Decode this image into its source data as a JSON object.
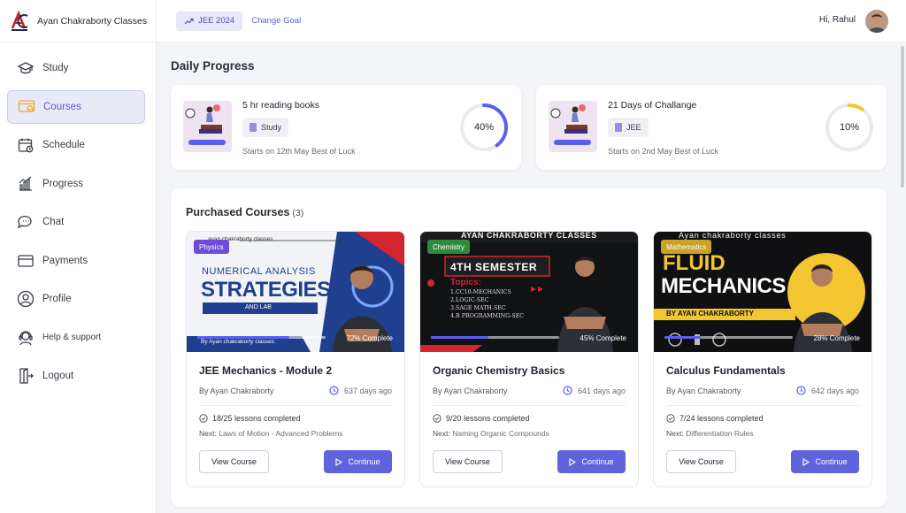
{
  "brand": {
    "name": "Ayan Chakraborty Classes"
  },
  "sidebar": {
    "items": [
      {
        "label": "Study",
        "icon": "graduation-cap-icon"
      },
      {
        "label": "Courses",
        "icon": "courses-icon",
        "active": true
      },
      {
        "label": "Schedule",
        "icon": "calendar-icon"
      },
      {
        "label": "Progress",
        "icon": "progress-icon"
      },
      {
        "label": "Chat",
        "icon": "chat-icon"
      },
      {
        "label": "Payments",
        "icon": "card-icon"
      },
      {
        "label": "Profile",
        "icon": "user-icon"
      },
      {
        "label": "Help & support",
        "icon": "headset-icon"
      },
      {
        "label": "Logout",
        "icon": "logout-icon"
      }
    ]
  },
  "topbar": {
    "goal": "JEE 2024",
    "change_goal": "Change Goal",
    "greeting": "Hi, Rahul"
  },
  "daily_progress": {
    "title": "Daily Progress",
    "cards": [
      {
        "title": "5 hr reading books",
        "tag": "Study",
        "subtitle": "Starts on 12th May Best of Luck",
        "percent": 40,
        "percent_label": "40%",
        "ring_color": "#5b5ff0"
      },
      {
        "title": "21 Days of Challange",
        "tag": "JEE",
        "subtitle": "Starts on 2nd May Best of Luck",
        "percent": 10,
        "percent_label": "10%",
        "ring_color": "#f2c531"
      }
    ]
  },
  "purchased": {
    "title": "Purchased Courses",
    "count": "(3)",
    "courses": [
      {
        "subject": "Physics",
        "subject_color": "#6f4bd8",
        "title": "JEE Mechanics - Module 2",
        "author": "By Ayan Chakraborty",
        "ago": "637 days ago",
        "progress": 72,
        "progress_label": "72% Complete",
        "lessons": "18/25 lessons completed",
        "next_label": "Next:",
        "next_topic": "Laws of Motion - Advanced Problems",
        "view_label": "View Course",
        "continue_label": "Continue",
        "banner": {
          "header": "ayan chakraborty classes",
          "line1": "NUMERICAL ANALYSIS",
          "line2": "STRATEGIES",
          "line3": "AND LAB",
          "footer": "By Ayan chakraborty classes"
        }
      },
      {
        "subject": "Chemistry",
        "subject_color": "#2e8b3d",
        "title": "Organic Chemistry Basics",
        "author": "By Ayan Chakraborty",
        "ago": "641 days ago",
        "progress": 45,
        "progress_label": "45% Complete",
        "lessons": "9/20 lessons completed",
        "next_label": "Next:",
        "next_topic": "Naming Organic Compounds",
        "view_label": "View Course",
        "continue_label": "Continue",
        "banner": {
          "header": "AYAN CHAKRABORTY CLASSES",
          "line1": "4TH SEMESTER",
          "topics": "Topics:",
          "t1": "1.CC10-MECHANICS",
          "t2": "2.LOGIC-SEC",
          "t3": "3.SAGE MATH-SEC",
          "t4": "4.R PROGRAMMING-SEC"
        }
      },
      {
        "subject": "Mathematics",
        "subject_color": "#c9a227",
        "title": "Calculus Fundamentals",
        "author": "By Ayan Chakraborty",
        "ago": "642 days ago",
        "progress": 28,
        "progress_label": "28% Complete",
        "lessons": "7/24 lessons completed",
        "next_label": "Next:",
        "next_topic": "Differentiation Rules",
        "view_label": "View Course",
        "continue_label": "Continue",
        "banner": {
          "header": "Ayan chakraborty classes",
          "line1": "FLUID",
          "line2": "MECHANICS",
          "line3": "BY AYAN CHAKRABORTY"
        }
      }
    ]
  }
}
